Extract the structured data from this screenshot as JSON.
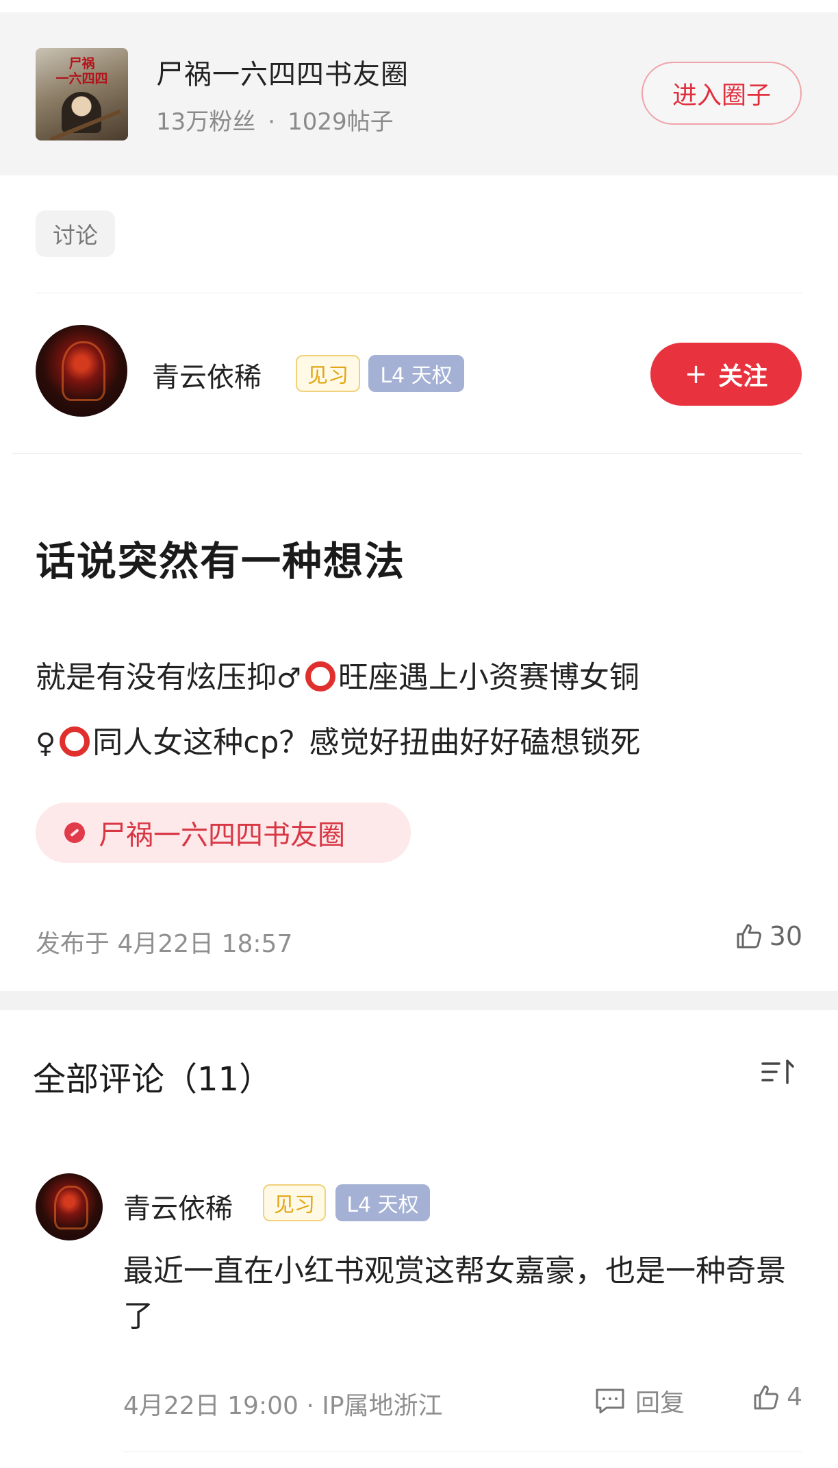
{
  "circle": {
    "name": "尸祸一六四四书友圈",
    "fans": "13万粉丝",
    "separator": "·",
    "posts": "1029帖子",
    "enter_label": "进入圈子",
    "cover_text": "尸祸\n一六四四"
  },
  "post": {
    "tag": "讨论",
    "author": {
      "name": "青云依稀",
      "level_badge": "见习",
      "rank_badge": "L4 天权"
    },
    "follow_label": "关注",
    "follow_icon": "plus-icon",
    "title": "话说突然有一种想法",
    "body": {
      "line1_a": "就是有没有炫压抑",
      "line1_sym": "♂",
      "line1_b": "旺座遇上小资赛博女铜",
      "line2_sym": "♀",
      "line2_b": "同人女这种cp？感觉好扭曲好好磕想锁死"
    },
    "circle_pill": "尸祸一六四四书友圈",
    "published": "发布于 4月22日 18:57",
    "likes": "30"
  },
  "comments": {
    "title": "全部评论（11）",
    "sort_icon": "sort-icon",
    "items": [
      {
        "author": "青云依稀",
        "level_badge": "见习",
        "rank_badge": "L4 天权",
        "text": "最近一直在小红书观赏这帮女嘉豪，也是一种奇景了",
        "meta": "4月22日 19:00 · IP属地浙江",
        "reply_label": "回复",
        "likes": "4"
      }
    ]
  },
  "colors": {
    "accent_red": "#e8333f",
    "header_bg": "#f4f4f4",
    "level_badge": "#e0a615",
    "rank_badge": "#a4b1d4",
    "ring": "#e0302d"
  }
}
